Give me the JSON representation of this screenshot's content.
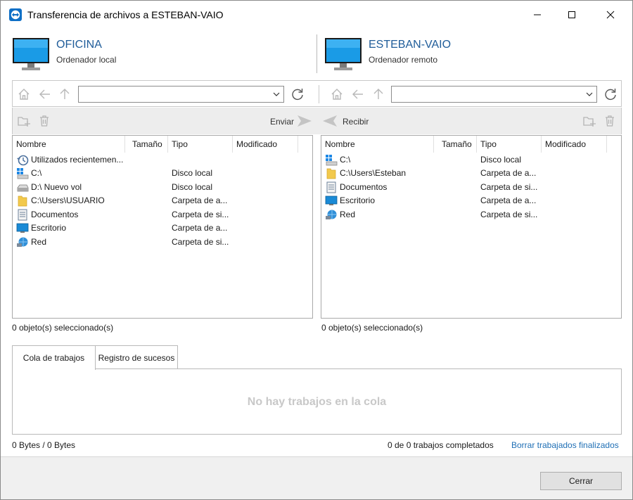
{
  "window": {
    "title": "Transferencia de archivos a ESTEBAN-VAIO",
    "accent": "#1f5c99",
    "controls": [
      "minimize-icon",
      "maximize-icon",
      "close-icon"
    ]
  },
  "local": {
    "name": "OFICINA",
    "subtitle": "Ordenador local",
    "path": "",
    "send_label": "Enviar",
    "columns": [
      "Nombre",
      "Tamaño",
      "Tipo",
      "Modificado"
    ],
    "rows": [
      {
        "icon": "recent-icon",
        "name": "Utilizados recientemen...",
        "type": ""
      },
      {
        "icon": "windows-drive-icon",
        "name": "C:\\",
        "type": "Disco local"
      },
      {
        "icon": "drive-icon",
        "name": "D:\\  Nuevo vol",
        "type": "Disco local"
      },
      {
        "icon": "folder-icon",
        "name": "C:\\Users\\USUARIO",
        "type": "Carpeta de a..."
      },
      {
        "icon": "documents-icon",
        "name": "Documentos",
        "type": "Carpeta de si..."
      },
      {
        "icon": "desktop-icon",
        "name": "Escritorio",
        "type": "Carpeta de a..."
      },
      {
        "icon": "network-icon",
        "name": "Red",
        "type": "Carpeta de si..."
      }
    ],
    "status": "0 objeto(s) seleccionado(s)"
  },
  "remote": {
    "name": "ESTEBAN-VAIO",
    "subtitle": "Ordenador remoto",
    "path": "",
    "receive_label": "Recibir",
    "columns": [
      "Nombre",
      "Tamaño",
      "Tipo",
      "Modificado"
    ],
    "rows": [
      {
        "icon": "windows-drive-icon",
        "name": "C:\\",
        "type": "Disco local"
      },
      {
        "icon": "folder-icon",
        "name": "C:\\Users\\Esteban",
        "type": "Carpeta de a..."
      },
      {
        "icon": "documents-icon",
        "name": "Documentos",
        "type": "Carpeta de si..."
      },
      {
        "icon": "desktop-icon",
        "name": "Escritorio",
        "type": "Carpeta de a..."
      },
      {
        "icon": "network-icon",
        "name": "Red",
        "type": "Carpeta de si..."
      }
    ],
    "status": "0 objeto(s) seleccionado(s)"
  },
  "tabs": {
    "queue": "Cola de trabajos",
    "log": "Registro de sucesos"
  },
  "queue": {
    "empty_message": "No hay trabajos en la cola"
  },
  "footer": {
    "bytes": "0 Bytes / 0 Bytes",
    "jobs": "0 de 0 trabajos completados",
    "clear_link": "Borrar trabajados finalizados",
    "close_button": "Cerrar"
  }
}
